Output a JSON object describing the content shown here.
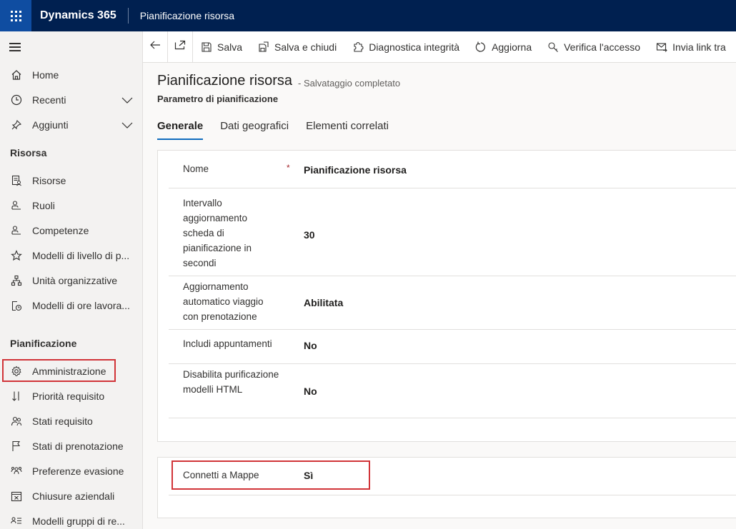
{
  "topbar": {
    "app_name": "Dynamics 365",
    "page_name": "Pianificazione risorsa"
  },
  "sidebar": {
    "items_top": [
      {
        "label": "Home",
        "icon": "home-icon"
      },
      {
        "label": "Recenti",
        "icon": "clock-icon",
        "expandable": true
      },
      {
        "label": "Aggiunti",
        "icon": "pin-icon",
        "expandable": true
      }
    ],
    "section_risorsa": "Risorsa",
    "items_risorsa": [
      {
        "label": "Risorse",
        "icon": "resource-icon"
      },
      {
        "label": "Ruoli",
        "icon": "person-icon"
      },
      {
        "label": "Competenze",
        "icon": "person-icon"
      },
      {
        "label": "Modelli di livello di p...",
        "icon": "star-icon"
      },
      {
        "label": "Unità organizzative",
        "icon": "org-icon"
      },
      {
        "label": "Modelli di ore lavora...",
        "icon": "calendar-clock-icon"
      }
    ],
    "section_pianificazione": "Pianificazione",
    "items_pianificazione": [
      {
        "label": "Amministrazione",
        "icon": "gear-icon"
      },
      {
        "label": "Priorità requisito",
        "icon": "sort-icon"
      },
      {
        "label": "Stati requisito",
        "icon": "people-icon"
      },
      {
        "label": "Stati di prenotazione",
        "icon": "flag-icon"
      },
      {
        "label": "Preferenze evasione",
        "icon": "people-group-icon"
      },
      {
        "label": "Chiusure aziendali",
        "icon": "calendar-x-icon"
      },
      {
        "label": "Modelli gruppi di re...",
        "icon": "list-person-icon"
      }
    ]
  },
  "commandbar": {
    "back": "back-icon",
    "popout": "popout-icon",
    "save": "Salva",
    "save_close": "Salva e chiudi",
    "diagnostics": "Diagnostica integrità",
    "refresh": "Aggiorna",
    "check_access": "Verifica l'accesso",
    "send_link": "Invia link tra"
  },
  "record": {
    "title": "Pianificazione risorsa",
    "status": "- Salvataggio completato",
    "entity": "Parametro di pianificazione"
  },
  "tabs": [
    "Generale",
    "Dati geografici",
    "Elementi correlati"
  ],
  "fields": [
    {
      "label": "Nome",
      "required": "*",
      "value": "Pianificazione risorsa"
    },
    {
      "label": "Intervallo aggiornamento scheda di pianificazione in secondi",
      "required": "",
      "value": "30"
    },
    {
      "label": "Aggiornamento automatico viaggio con prenotazione",
      "required": "",
      "value": "Abilitata"
    },
    {
      "label": "Includi appuntamenti",
      "required": "",
      "value": "No"
    },
    {
      "label": "Disabilita purificazione modelli HTML",
      "required": "",
      "value": "No"
    }
  ],
  "fields2": [
    {
      "label": "Connetti a Mappe",
      "value": "Sì"
    }
  ],
  "colors": {
    "topbar": "#002050",
    "waffle": "#0f4da1",
    "highlight": "#d13438",
    "accent": "#0f6cbd"
  }
}
